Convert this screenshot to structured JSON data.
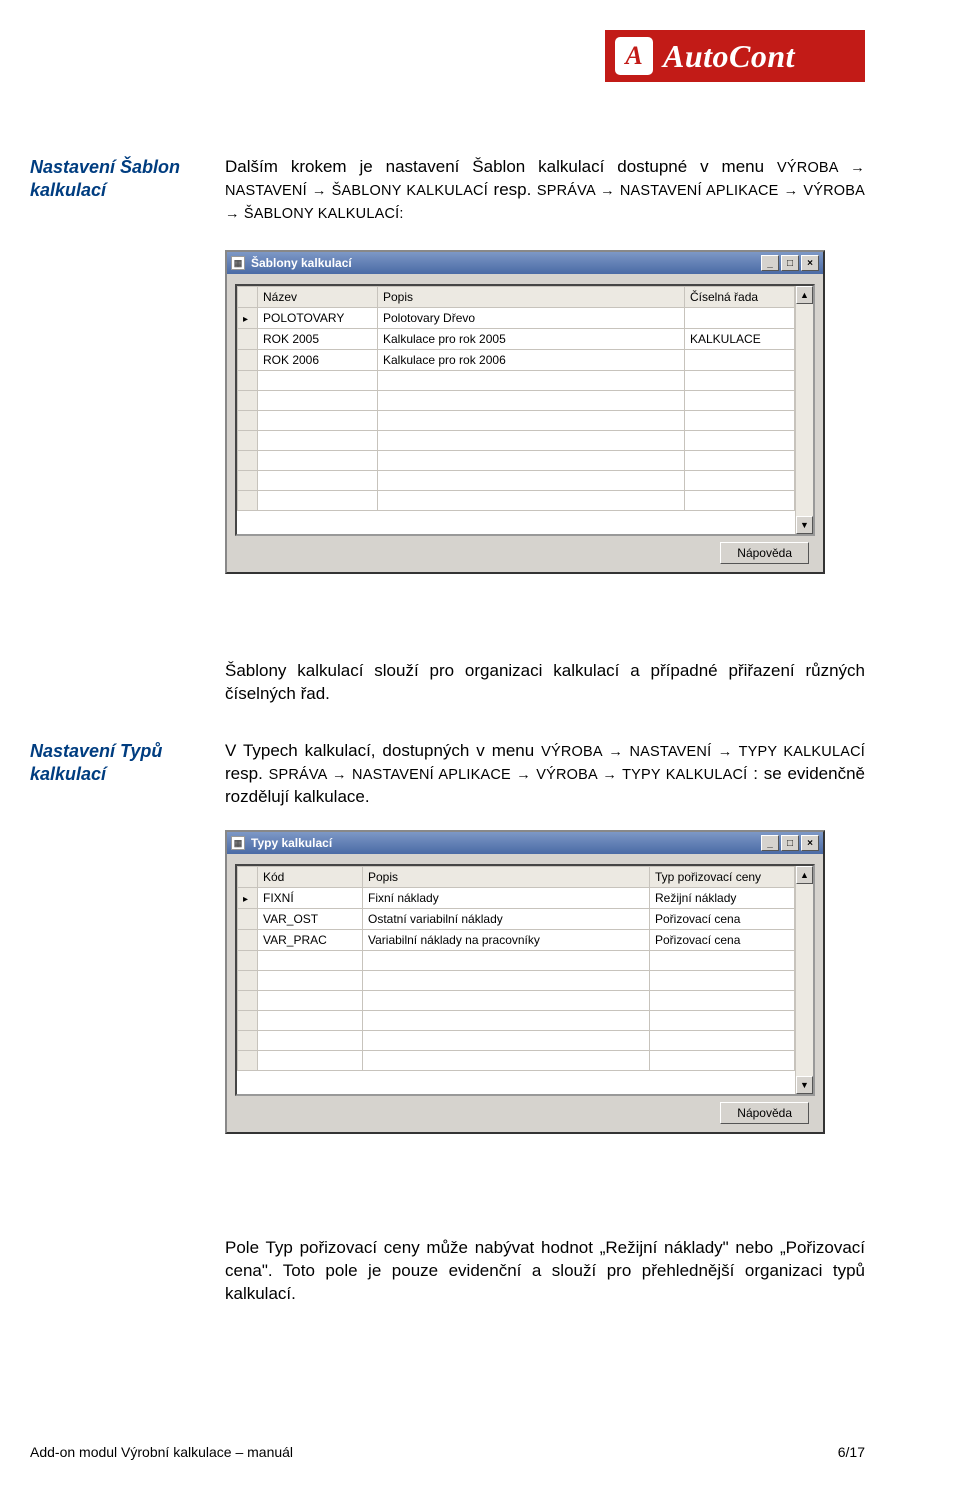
{
  "brand": {
    "mark": "A",
    "name": "AutoCont"
  },
  "sideLabels": {
    "s1a": "Nastavení Šablon",
    "s1b": "kalkulací",
    "s2a": "Nastavení Typů",
    "s2b": "kalkulací"
  },
  "paragraphs": {
    "p1_a": "Dalším krokem je nastavení Šablon kalkulací dostupné v menu ",
    "p1_b": "VÝROBA → NASTAVENÍ → ŠABLONY KALKULACÍ",
    "p1_c": " resp. ",
    "p1_d": "SPRÁVA → NASTAVENÍ APLIKACE → VÝROBA → ŠABLONY KALKULACÍ:",
    "p2": "Šablony kalkulací slouží pro organizaci kalkulací a případné přiřazení různých číselných řad.",
    "p3_a": "V Typech kalkulací, dostupných v  menu ",
    "p3_b": "VÝROBA → NASTAVENÍ → TYPY KALKULACÍ",
    "p3_c": " resp. ",
    "p3_d": "SPRÁVA → NASTAVENÍ APLIKACE → VÝROBA → TYPY KALKULACÍ",
    "p3_e": ": se evidenčně rozdělují kalkulace.",
    "p4": "Pole Typ pořizovací ceny může nabývat hodnot „Režijní náklady\" nebo „Pořizovací cena\". Toto pole je pouze evidenční a slouží pro přehlednější organizaci typů kalkulací."
  },
  "window1": {
    "title": "Šablony kalkulací",
    "columns": [
      "Název",
      "Popis",
      "Číselná řada"
    ],
    "rows": [
      {
        "sel": true,
        "c": [
          "POLOTOVARY",
          "Polotovary Dřevo",
          ""
        ]
      },
      {
        "sel": false,
        "c": [
          "ROK 2005",
          "Kalkulace pro rok 2005",
          "KALKULACE"
        ]
      },
      {
        "sel": false,
        "c": [
          "ROK 2006",
          "Kalkulace pro rok 2006",
          ""
        ]
      },
      {
        "sel": false,
        "c": [
          "",
          "",
          ""
        ]
      },
      {
        "sel": false,
        "c": [
          "",
          "",
          ""
        ]
      },
      {
        "sel": false,
        "c": [
          "",
          "",
          ""
        ]
      },
      {
        "sel": false,
        "c": [
          "",
          "",
          ""
        ]
      },
      {
        "sel": false,
        "c": [
          "",
          "",
          ""
        ]
      },
      {
        "sel": false,
        "c": [
          "",
          "",
          ""
        ]
      },
      {
        "sel": false,
        "c": [
          "",
          "",
          ""
        ]
      }
    ],
    "helpBtn": "Nápověda"
  },
  "window2": {
    "title": "Typy kalkulací",
    "columns": [
      "Kód",
      "Popis",
      "Typ pořizovací ceny"
    ],
    "rows": [
      {
        "sel": true,
        "c": [
          "FIXNÍ",
          "Fixní náklady",
          "Režijní náklady"
        ]
      },
      {
        "sel": false,
        "c": [
          "VAR_OST",
          "Ostatní variabilní náklady",
          "Pořizovací cena"
        ]
      },
      {
        "sel": false,
        "c": [
          "VAR_PRAC",
          "Variabilní náklady na pracovníky",
          "Pořizovací cena"
        ]
      },
      {
        "sel": false,
        "c": [
          "",
          "",
          ""
        ]
      },
      {
        "sel": false,
        "c": [
          "",
          "",
          ""
        ]
      },
      {
        "sel": false,
        "c": [
          "",
          "",
          ""
        ]
      },
      {
        "sel": false,
        "c": [
          "",
          "",
          ""
        ]
      },
      {
        "sel": false,
        "c": [
          "",
          "",
          ""
        ]
      },
      {
        "sel": false,
        "c": [
          "",
          "",
          ""
        ]
      }
    ],
    "helpBtn": "Nápověda"
  },
  "winButtons": {
    "min": "_",
    "max": "□",
    "close": "×"
  },
  "scroll": {
    "up": "▲",
    "down": "▼"
  },
  "footer": {
    "left": "Add-on modul Výrobní kalkulace – manuál",
    "right": "6/17"
  }
}
